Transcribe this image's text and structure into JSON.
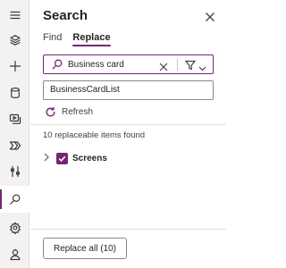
{
  "rail": {
    "icons": [
      {
        "name": "hamburger-menu-icon",
        "active": false
      },
      {
        "name": "tree-view-layers-icon",
        "active": false
      },
      {
        "name": "insert-plus-icon",
        "active": false
      },
      {
        "name": "data-database-icon",
        "active": false
      },
      {
        "name": "media-icon",
        "active": false
      },
      {
        "name": "power-automate-icon",
        "active": false
      },
      {
        "name": "advanced-tools-icon",
        "active": false
      },
      {
        "name": "search-icon",
        "active": true
      },
      {
        "name": "settings-gear-icon",
        "active": false
      },
      {
        "name": "virtual-agent-icon",
        "active": false
      }
    ]
  },
  "panel": {
    "title": "Search",
    "tabs": [
      {
        "label": "Find",
        "active": false
      },
      {
        "label": "Replace",
        "active": true
      }
    ],
    "search": {
      "value": "Business card"
    },
    "replace": {
      "value": "BusinessCardList"
    },
    "refresh_label": "Refresh",
    "results_count": "10 replaceable items found",
    "tree": [
      {
        "label": "Screens",
        "checked": true,
        "expanded": false
      }
    ],
    "replace_all_label": "Replace all (10)"
  },
  "colors": {
    "accent": "#742774",
    "rail_bg": "#f3f2f1",
    "border": "#8a8886",
    "divider": "#e1dfdd"
  }
}
